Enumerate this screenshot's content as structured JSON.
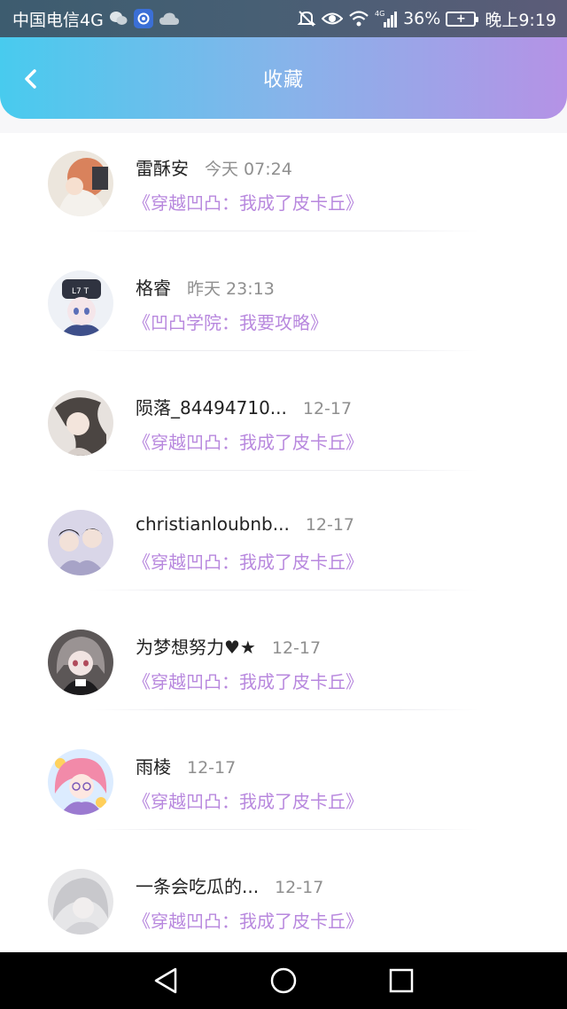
{
  "status_bar": {
    "carrier": "中国电信4G",
    "battery": "36%",
    "time": "晚上9:19",
    "icons": [
      "wechat-icon",
      "app-badge-icon",
      "cloud-icon",
      "mute-icon",
      "eye-icon",
      "wifi-icon",
      "signal-icon",
      "battery-icon"
    ]
  },
  "header": {
    "title": "收藏",
    "back_icon": "chevron-left-icon"
  },
  "favorites": [
    {
      "name": "雷酥安",
      "time": "今天 07:24",
      "book": "《穿越凹凸：我成了皮卡丘》",
      "avatar_color": "#d98a63"
    },
    {
      "name": "格睿",
      "time": "昨天 23:13",
      "book": "《凹凸学院：我要攻略》",
      "avatar_color": "#4a5b87"
    },
    {
      "name": "陨落_84494710...",
      "time": "12-17",
      "book": "《穿越凹凸：我成了皮卡丘》",
      "avatar_color": "#6b6460"
    },
    {
      "name": "christianloubnb...",
      "time": "12-17",
      "book": "《穿越凹凸：我成了皮卡丘》",
      "avatar_color": "#8a86a8"
    },
    {
      "name": "为梦想努力♥★",
      "time": "12-17",
      "book": "《穿越凹凸：我成了皮卡丘》",
      "avatar_color": "#6e6868"
    },
    {
      "name": "雨棱",
      "time": "12-17",
      "book": "《穿越凹凸：我成了皮卡丘》",
      "avatar_color": "#f08fb0"
    },
    {
      "name": "一条会吃瓜的...",
      "time": "12-17",
      "book": "《穿越凹凸：我成了皮卡丘》",
      "avatar_color": "#cfcfd2"
    }
  ],
  "nav_bar": {
    "back": "nav-back-icon",
    "home": "nav-home-icon",
    "recent": "nav-recent-icon"
  }
}
